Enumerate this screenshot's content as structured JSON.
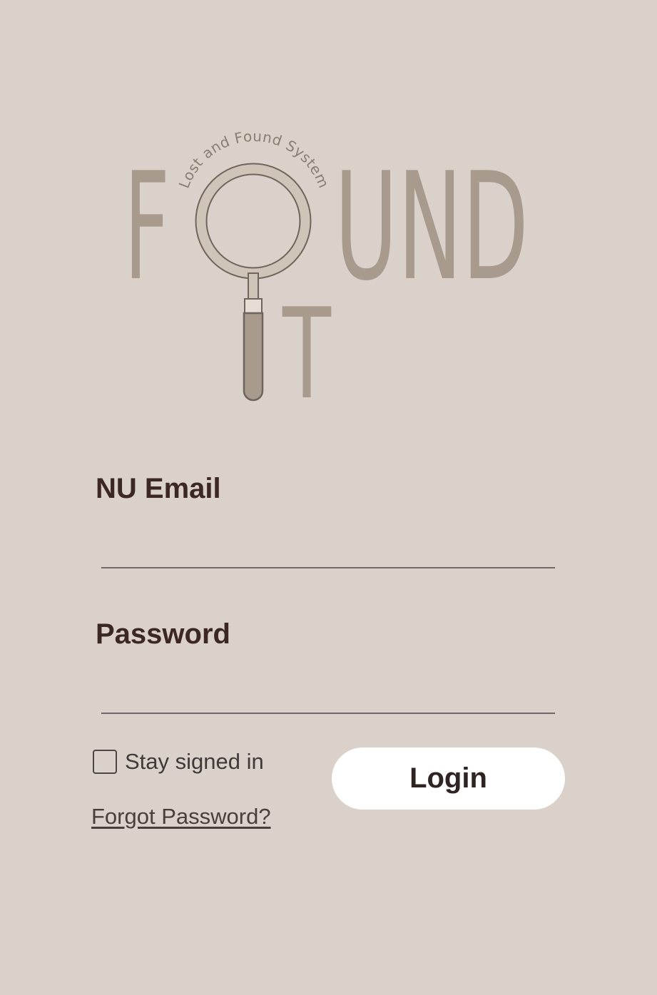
{
  "logo": {
    "word_top": "F",
    "word_top_rest": "UND",
    "word_bottom": "T",
    "tagline": "Lost and Found System",
    "colors": {
      "letters": "#a89a8c",
      "lens_ring": "#cfc4b8",
      "outline": "#6f655c"
    }
  },
  "form": {
    "email_label": "NU Email",
    "email_value": "",
    "password_label": "Password",
    "password_value": "",
    "stay_signed_in_label": "Stay signed in",
    "stay_signed_in_checked": false,
    "forgot_password_label": "Forgot Password?",
    "login_label": "Login"
  },
  "colors": {
    "background": "#d9d1ca",
    "label_text": "#3d2722",
    "button_bg": "#ffffff",
    "input_line": "#6f6a69"
  },
  "icons": {
    "logo_magnifier": "magnifier-icon"
  }
}
